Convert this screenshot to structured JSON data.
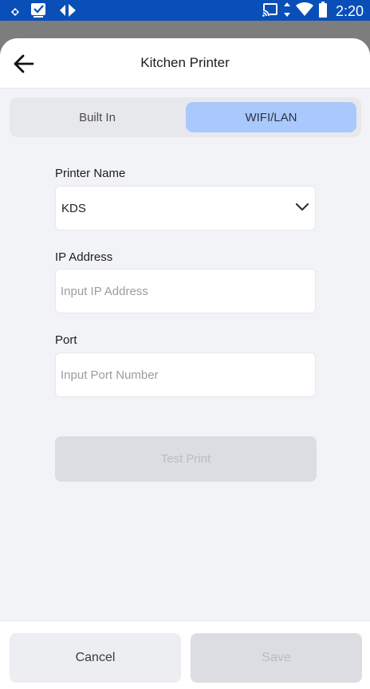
{
  "status_bar": {
    "time": "2:20",
    "left_icons": [
      "notification-dot-icon",
      "checkbox-icon",
      "diamond-arrows-icon"
    ],
    "right_icons": [
      "cast-icon",
      "data-arrows-icon",
      "wifi-icon",
      "battery-icon"
    ],
    "color": "#0a4fb8"
  },
  "header": {
    "title": "Kitchen Printer",
    "back_icon": "back-arrow-icon"
  },
  "segmented": {
    "tabs": [
      {
        "label": "Built In",
        "selected": false
      },
      {
        "label": "WIFI/LAN",
        "selected": true
      }
    ],
    "selected_color": "#a9c8fb"
  },
  "form": {
    "printer_name": {
      "label": "Printer Name",
      "value": "KDS"
    },
    "ip_address": {
      "label": "IP Address",
      "value": "",
      "placeholder": "Input IP Address"
    },
    "port": {
      "label": "Port",
      "value": "",
      "placeholder": "Input Port Number"
    },
    "test_print_label": "Test Print"
  },
  "footer": {
    "cancel_label": "Cancel",
    "save_label": "Save"
  }
}
